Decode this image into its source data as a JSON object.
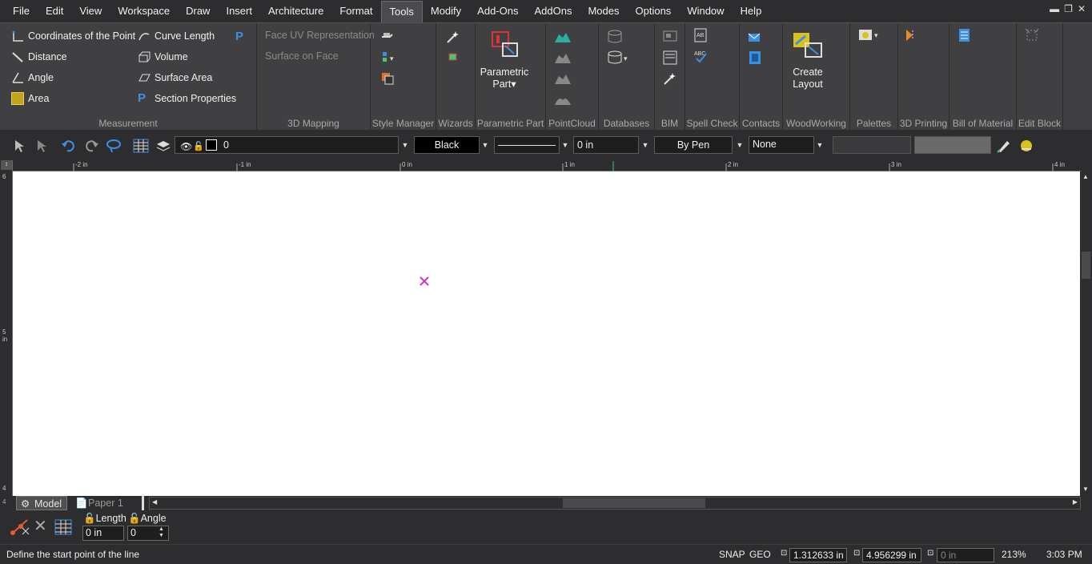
{
  "menubar": {
    "items": [
      "File",
      "Edit",
      "View",
      "Workspace",
      "Draw",
      "Insert",
      "Architecture",
      "Format",
      "Tools",
      "Modify",
      "Add-Ons",
      "AddOns",
      "Modes",
      "Options",
      "Window",
      "Help"
    ],
    "active": "Tools"
  },
  "ribbon": {
    "measurement": {
      "title": "Measurement",
      "coordinates": "Coordinates of the Point",
      "curve_length": "Curve Length",
      "distance": "Distance",
      "volume": "Volume",
      "angle": "Angle",
      "surface_area": "Surface Area",
      "area": "Area",
      "section_properties": "Section Properties"
    },
    "mapping": {
      "title": "3D Mapping",
      "face_uv": "Face UV Representation",
      "surface_on_face": "Surface on Face"
    },
    "style_manager": {
      "title": "Style Manager"
    },
    "wizards": {
      "title": "Wizards"
    },
    "parametric_part": {
      "title": "Parametric Part",
      "button": "Parametric",
      "button2": "Part"
    },
    "pointcloud": {
      "title": "PointCloud"
    },
    "databases": {
      "title": "Databases"
    },
    "bim": {
      "title": "BIM"
    },
    "spellcheck": {
      "title": "Spell Check"
    },
    "contacts": {
      "title": "Contacts"
    },
    "woodworking": {
      "title": "WoodWorking",
      "button": "Create",
      "button2": "Layout"
    },
    "palettes": {
      "title": "Palettes"
    },
    "printing": {
      "title": "3D Printing"
    },
    "bom": {
      "title": "Bill of Material"
    },
    "editblock": {
      "title": "Edit Block"
    }
  },
  "toolbar": {
    "layer_value": "0",
    "color_value": "Black",
    "thickness_value": "0 in",
    "linestyle_value": "By Pen",
    "arrow_value": "None"
  },
  "ruler": {
    "top_ticks": [
      "-2 in",
      "-1 in",
      "0 in",
      "1 in",
      "2 in",
      "3 in",
      "4 in"
    ],
    "left_ticks": [
      "6",
      "5 in",
      "4"
    ]
  },
  "tabs": {
    "model": "Model",
    "paper": "Paper 1"
  },
  "inspector": {
    "length_label": "Length",
    "length_value": "0 in",
    "angle_label": "Angle",
    "angle_value": "0"
  },
  "status": {
    "prompt": "Define the start point of the line",
    "snap": "SNAP",
    "geo": "GEO",
    "x_value": "1.312633 in",
    "y_value": "4.956299 in",
    "z_value": "0 in",
    "zoom": "213%",
    "time": "3:03 PM"
  },
  "colors": {
    "accent": "#cc33cc",
    "icon_blue": "#3d8fe0",
    "icon_yellow": "#d9c21a",
    "toolbar_bg": "#2d2d30",
    "ribbon_bg": "#404043"
  }
}
